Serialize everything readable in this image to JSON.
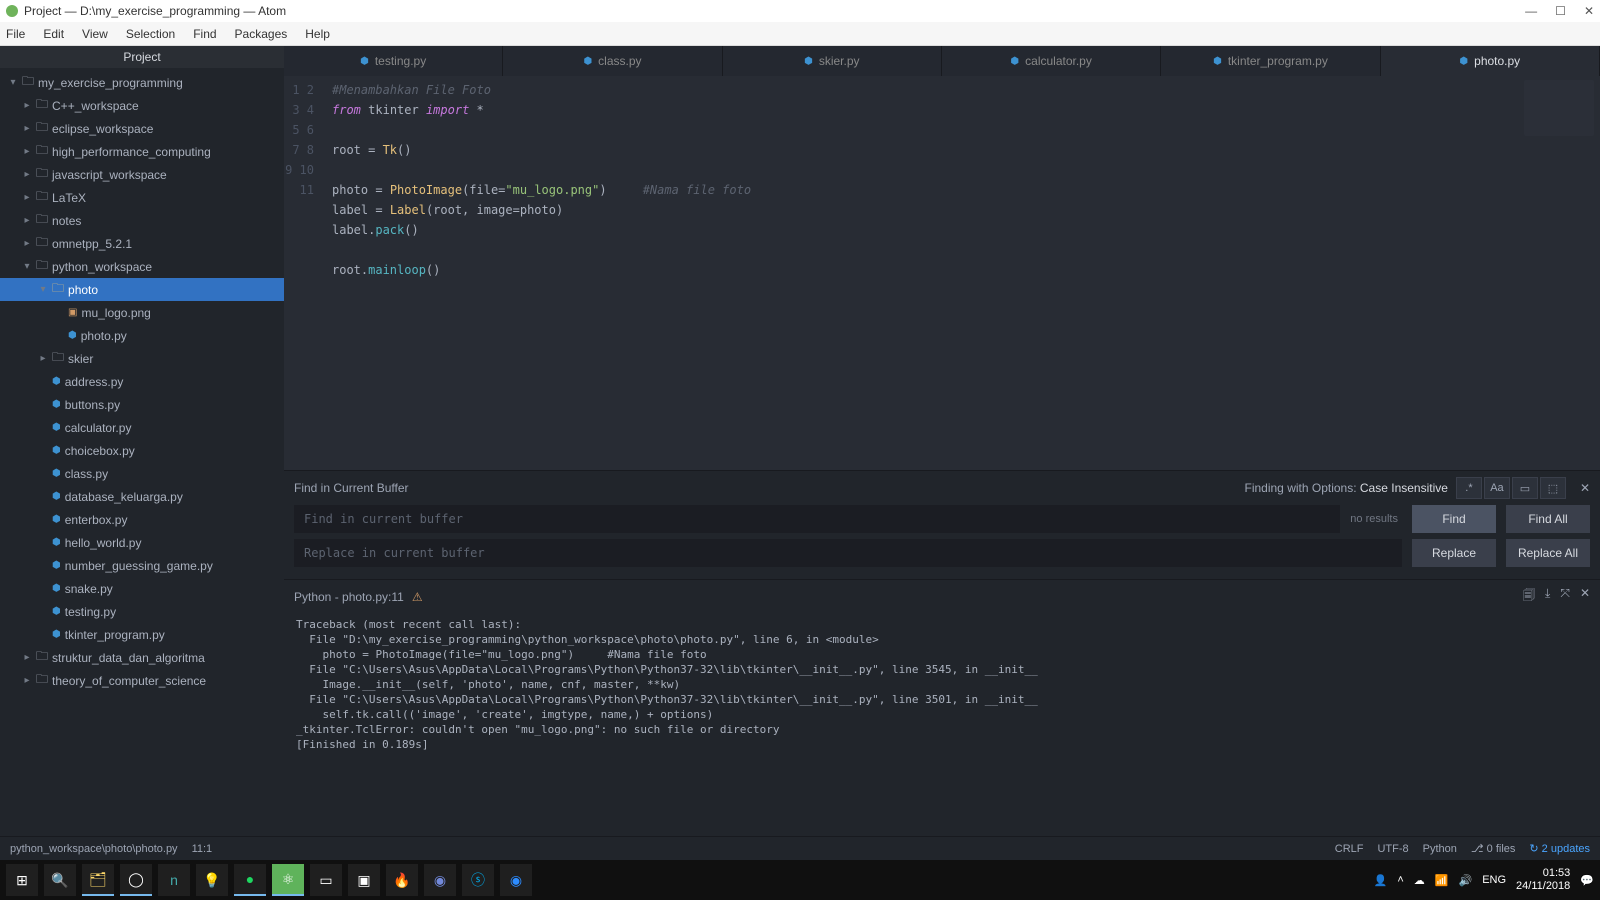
{
  "window": {
    "title": "Project — D:\\my_exercise_programming — Atom"
  },
  "menu": [
    "File",
    "Edit",
    "View",
    "Selection",
    "Find",
    "Packages",
    "Help"
  ],
  "sidebar": {
    "title": "Project",
    "root": "my_exercise_programming",
    "folders_l1": [
      "C++_workspace",
      "eclipse_workspace",
      "high_performance_computing",
      "javascript_workspace",
      "LaTeX",
      "notes",
      "omnetpp_5.2.1"
    ],
    "py_ws": "python_workspace",
    "photo": "photo",
    "photo_children": {
      "img": "mu_logo.png",
      "py": "photo.py"
    },
    "skier": "skier",
    "py_files": [
      "address.py",
      "buttons.py",
      "calculator.py",
      "choicebox.py",
      "class.py",
      "database_keluarga.py",
      "enterbox.py",
      "hello_world.py",
      "number_guessing_game.py",
      "snake.py",
      "testing.py",
      "tkinter_program.py"
    ],
    "tail_folders": [
      "struktur_data_dan_algoritma",
      "theory_of_computer_science"
    ]
  },
  "tabs": [
    "testing.py",
    "class.py",
    "skier.py",
    "calculator.py",
    "tkinter_program.py",
    "photo.py"
  ],
  "active_tab": 5,
  "code": {
    "l1_cm": "#Menambahkan File Foto",
    "l2_from": "from",
    "l2_mod": "tkinter",
    "l2_import": "import",
    "l2_star": "*",
    "l4_root": "root ",
    "l4_eq": "= ",
    "l4_tk": "Tk",
    "l4_paren": "()",
    "l6_photo": "photo ",
    "l6_eq": "= ",
    "l6_pi": "PhotoImage",
    "l6_open": "(file=",
    "l6_str": "\"mu_logo.png\"",
    "l6_close": ")",
    "l6_pad": "     ",
    "l6_cm": "#Nama file foto",
    "l7_label": "label ",
    "l7_eq": "= ",
    "l7_lbl": "Label",
    "l7_args": "(root, image=photo)",
    "l8_label": "label.",
    "l8_pack": "pack",
    "l8_p": "()",
    "l10_root": "root.",
    "l10_main": "mainloop",
    "l10_p": "()"
  },
  "find": {
    "title": "Find in Current Buffer",
    "options_label": "Finding with Options: ",
    "options_value": "Case Insensitive",
    "placeholder_find": "Find in current buffer",
    "placeholder_replace": "Replace in current buffer",
    "no_results": "no results",
    "btn_find": "Find",
    "btn_find_all": "Find All",
    "btn_replace": "Replace",
    "btn_replace_all": "Replace All"
  },
  "terminal": {
    "title": "Python - photo.py:11",
    "output": "Traceback (most recent call last):\n  File \"D:\\my_exercise_programming\\python_workspace\\photo\\photo.py\", line 6, in <module>\n    photo = PhotoImage(file=\"mu_logo.png\")     #Nama file foto\n  File \"C:\\Users\\Asus\\AppData\\Local\\Programs\\Python\\Python37-32\\lib\\tkinter\\__init__.py\", line 3545, in __init__\n    Image.__init__(self, 'photo', name, cnf, master, **kw)\n  File \"C:\\Users\\Asus\\AppData\\Local\\Programs\\Python\\Python37-32\\lib\\tkinter\\__init__.py\", line 3501, in __init__\n    self.tk.call(('image', 'create', imgtype, name,) + options)\n_tkinter.TclError: couldn't open \"mu_logo.png\": no such file or directory\n[Finished in 0.189s]"
  },
  "status": {
    "path": "python_workspace\\photo\\photo.py",
    "cursor": "11:1",
    "eol": "CRLF",
    "encoding": "UTF-8",
    "lang": "Python",
    "git": "0 files",
    "updates": "2 updates"
  },
  "tray": {
    "lang": "ENG",
    "time": "01:53",
    "date": "24/11/2018"
  }
}
